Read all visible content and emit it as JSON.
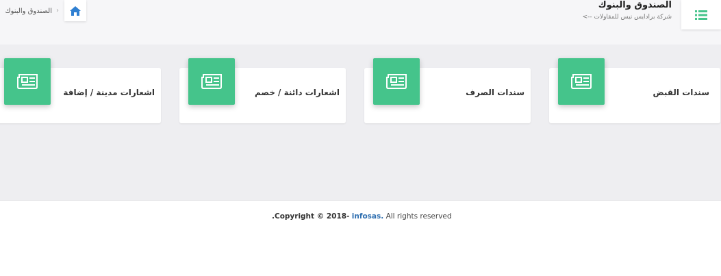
{
  "header": {
    "title": "الصندوق والبنوك",
    "subtitle": "شركة برادايس نيس للمقاولات -->",
    "breadcrumb": {
      "separator": "›",
      "current": "الصندوق والبنوك"
    },
    "menu_icon": "list-icon",
    "home_icon": "home-icon"
  },
  "cards": [
    {
      "label": "سندات القبض",
      "icon": "newspaper-icon"
    },
    {
      "label": "سندات الصرف",
      "icon": "newspaper-icon"
    },
    {
      "label": "اشعارات دائنة / خصم",
      "icon": "newspaper-icon"
    },
    {
      "label": "اشعارات مدينة / إضافة",
      "icon": "newspaper-icon"
    }
  ],
  "footer": {
    "copyright_prefix": ".Copyright © 2018-",
    "brand": "infosas.",
    "suffix": "All rights reserved"
  },
  "colors": {
    "accent": "#45c48b",
    "brand_link": "#2f6fb0",
    "home_icon": "#2f7fd1"
  }
}
